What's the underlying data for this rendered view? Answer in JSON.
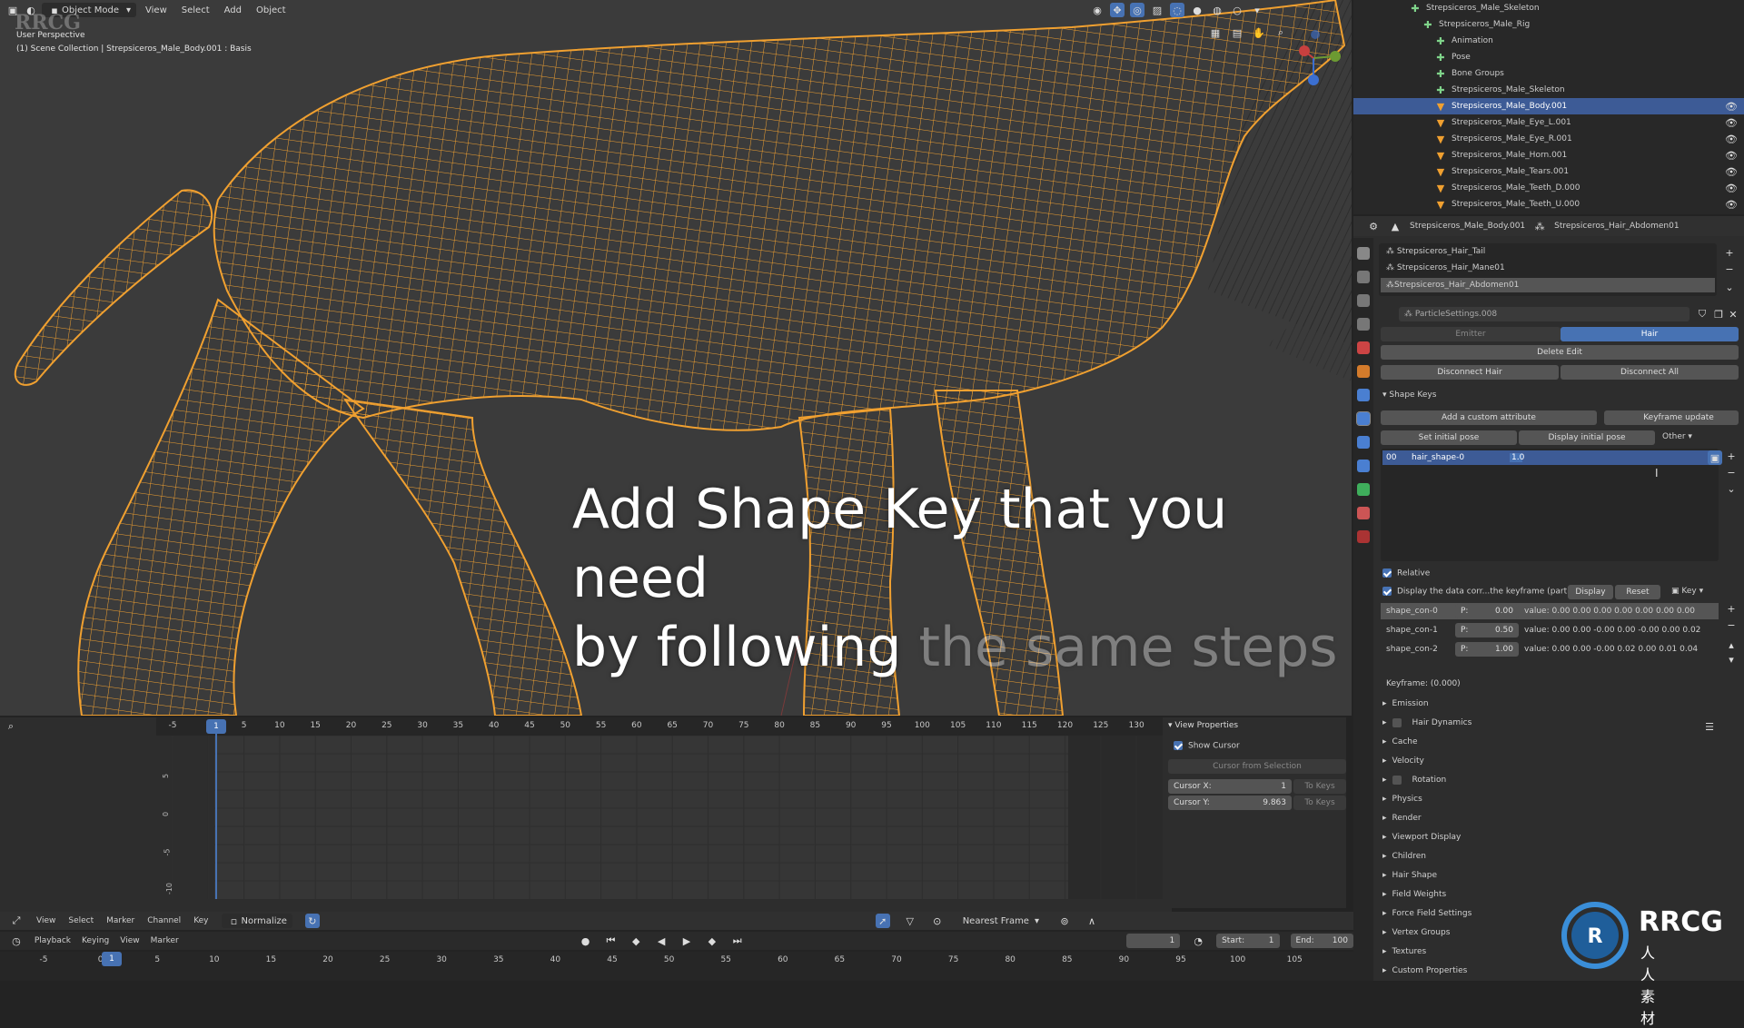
{
  "header": {
    "mode": "Object Mode",
    "menu": [
      "View",
      "Select",
      "Add",
      "Object"
    ]
  },
  "viewport": {
    "perspective": "User Perspective",
    "collection": "(1) Scene Collection | Strepsiceros_Male_Body.001 : Basis",
    "caption_line1": "Add Shape Key that you need",
    "caption_line2_visible": "by following",
    "caption_line2_faded": "the same steps",
    "wire_color": "#f0a030",
    "bg_color": "#3b3b3b"
  },
  "watermark": {
    "top_left": "RRCG"
  },
  "outliner": {
    "rows": [
      {
        "label": "Strepsiceros_Male_Skeleton",
        "indent": 60,
        "icon": "armature-icon"
      },
      {
        "label": "Strepsiceros_Male_Rig",
        "indent": 74,
        "icon": "armature-icon"
      },
      {
        "label": "Animation",
        "indent": 88,
        "icon": "action-icon"
      },
      {
        "label": "Pose",
        "indent": 88,
        "icon": "pose-icon"
      },
      {
        "label": "Bone Groups",
        "indent": 88,
        "icon": "group-icon"
      },
      {
        "label": "Strepsiceros_Male_Skeleton",
        "indent": 88,
        "icon": "bone-icon"
      },
      {
        "label": "Strepsiceros_Male_Body.001",
        "indent": 88,
        "icon": "mesh-icon",
        "selected": true
      },
      {
        "label": "Strepsiceros_Male_Eye_L.001",
        "indent": 88,
        "icon": "mesh-icon"
      },
      {
        "label": "Strepsiceros_Male_Eye_R.001",
        "indent": 88,
        "icon": "mesh-icon"
      },
      {
        "label": "Strepsiceros_Male_Horn.001",
        "indent": 88,
        "icon": "mesh-icon"
      },
      {
        "label": "Strepsiceros_Male_Tears.001",
        "indent": 88,
        "icon": "mesh-icon"
      },
      {
        "label": "Strepsiceros_Male_Teeth_D.000",
        "indent": 88,
        "icon": "mesh-icon"
      },
      {
        "label": "Strepsiceros_Male_Teeth_U.000",
        "indent": 88,
        "icon": "mesh-icon"
      }
    ]
  },
  "props": {
    "breadcrumb1": "Strepsiceros_Male_Body.001",
    "breadcrumb2": "Strepsiceros_Hair_Abdomen01",
    "particle_list": [
      "Strepsiceros_Hair_Tail",
      "Strepsiceros_Hair_Mane01",
      "Strepsiceros_Hair_Abdomen01"
    ],
    "settings_name": "ParticleSettings.008",
    "emitter": "Emitter",
    "hair": "Hair",
    "delete_edit": "Delete Edit",
    "disconnect_hair": "Disconnect Hair",
    "disconnect_all": "Disconnect All",
    "shape_keys": "Shape Keys",
    "add_custom_attr": "Add a custom attribute",
    "keyframe_update": "Keyframe update",
    "set_initial_pose": "Set initial pose",
    "display_initial_pose": "Display initial pose",
    "other": "Other",
    "shape_key_index": "00",
    "shape_key_name": "hair_shape-0",
    "shape_key_val": "1.0",
    "relative": "Relative",
    "display_data": "Display the data corr...the keyframe (partial)",
    "display": "Display",
    "reset": "Reset",
    "key": "Key",
    "shape_rows": [
      {
        "name": "shape_con-0",
        "p": "0.00",
        "value": "value: 0.00  0.00  0.00  0.00  0.00  0.00  0.00"
      },
      {
        "name": "shape_con-1",
        "p": "0.50",
        "value": "value: 0.00  0.00  -0.00  0.00  -0.00  0.00  0.02"
      },
      {
        "name": "shape_con-2",
        "p": "1.00",
        "value": "value: 0.00  0.00  -0.00  0.02  0.00  0.01  0.04"
      }
    ],
    "keyframe": "Keyframe: (0.000)",
    "sections": [
      "Emission",
      "Hair Dynamics",
      "Cache",
      "Velocity",
      "Rotation",
      "Physics",
      "Render",
      "Viewport Display",
      "Children",
      "Hair Shape",
      "Field Weights",
      "Force Field Settings",
      "Vertex Groups",
      "Textures",
      "Custom Properties"
    ]
  },
  "timeline": {
    "ticks": [
      "-5",
      "0",
      "5",
      "10",
      "15",
      "20",
      "25",
      "30",
      "35",
      "40",
      "45",
      "50",
      "55",
      "60",
      "65",
      "70",
      "75",
      "80",
      "85",
      "90",
      "95",
      "100",
      "105",
      "110",
      "115",
      "120",
      "125",
      "130"
    ],
    "current": "1",
    "y_labels": [
      "5",
      "0",
      "-5",
      "-10"
    ],
    "view_properties": "View Properties",
    "show_cursor": "Show Cursor",
    "cursor_from_selection": "Cursor from Selection",
    "cursor_x_label": "Cursor X:",
    "cursor_x": "1",
    "cursor_y_label": "Cursor Y:",
    "cursor_y": "9.863",
    "to_keys": "To Keys"
  },
  "graph_header": {
    "menu": [
      "View",
      "Select",
      "Marker",
      "Channel",
      "Key"
    ],
    "normalize": "Normalize",
    "snap": "Nearest Frame"
  },
  "playback_header": {
    "menu": [
      "Playback",
      "Keying",
      "View",
      "Marker"
    ],
    "frame": "1",
    "start_label": "Start:",
    "start": "1",
    "end_label": "End:",
    "end": "100"
  },
  "bottom_ticks": [
    "-5",
    "0",
    "5",
    "10",
    "15",
    "20",
    "25",
    "30",
    "35",
    "40",
    "45",
    "50",
    "55",
    "60",
    "65",
    "70",
    "75",
    "80",
    "85",
    "90",
    "95",
    "100",
    "105"
  ],
  "logo": {
    "title": "RRCG",
    "subtitle": "人人素材"
  }
}
